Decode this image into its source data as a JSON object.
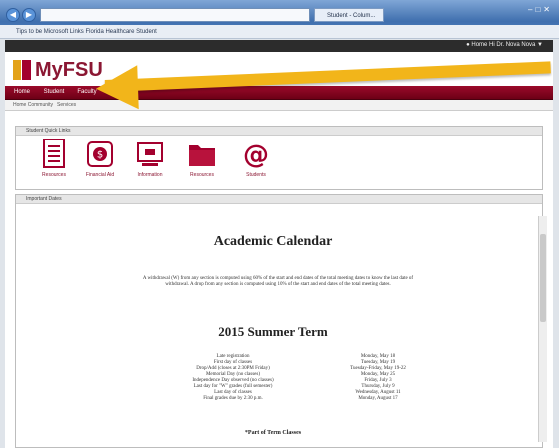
{
  "browser": {
    "tab_title": "Student - Colum...",
    "favorites": "Tips to be Microsoft Links    Florida Healthcare Student"
  },
  "site": {
    "user_strip": "● Home   Hi Dr. Nova Nova ▼",
    "logo": "MyFSU",
    "nav": [
      "Home",
      "Student",
      "Faculty"
    ],
    "subnav": [
      "Home Community",
      "Services"
    ],
    "quick_links_title": "Student Quick Links",
    "quick_links": [
      {
        "label": "Resources",
        "icon": "document-icon"
      },
      {
        "label": "Financial Aid",
        "icon": "money-icon"
      },
      {
        "label": "Information",
        "icon": "monitor-icon"
      },
      {
        "label": "Resources",
        "icon": "folder-icon"
      },
      {
        "label": "Students",
        "icon": "email-icon"
      }
    ],
    "important_dates_title": "Important Dates"
  },
  "document": {
    "title": "Academic Calendar",
    "paragraph": "A withdrawal (W) from any section is computed using 60% of the start and end dates of the total meeting dates to know the last date of withdrawal. A drop from any section is computed using 10% of the start and end dates of the total meeting dates.",
    "term": "2015 Summer Term",
    "rows": [
      [
        "Late registration",
        "Monday, May 18"
      ],
      [
        "First day of classes",
        "Tuesday, May 19"
      ],
      [
        "Drop/Add (closes at 2:30PM Friday)",
        "Tuesday-Friday, May 19-22"
      ],
      [
        "Memorial Day (no classes)",
        "Monday, May 25"
      ],
      [
        "Independence Day observed (no classes)",
        "Friday, July 3"
      ],
      [
        "Last day for \"W\" grades (full semester)",
        "Thursday, July 9"
      ],
      [
        "Last day of classes",
        "Wednesday, August 11"
      ],
      [
        "Final grades due by 2:30 p.m.",
        "Monday, August 17"
      ]
    ],
    "footer": "*Part of Term Classes"
  },
  "colors": {
    "brand_red": "#8b1733",
    "accent_gold": "#f2b51a"
  }
}
